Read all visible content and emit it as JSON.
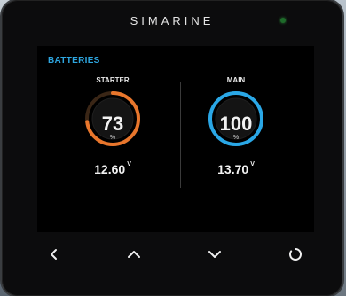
{
  "device": {
    "brand": "SIMARINE"
  },
  "screen": {
    "title": "BATTERIES",
    "batteries": [
      {
        "label": "STARTER",
        "percent": 73,
        "percent_text": "73",
        "unit": "%",
        "voltage": "12.60",
        "voltage_unit": "V",
        "ring_color": "#e8762c"
      },
      {
        "label": "MAIN",
        "percent": 100,
        "percent_text": "100",
        "unit": "%",
        "voltage": "13.70",
        "voltage_unit": "V",
        "ring_color": "#2aa7e6"
      }
    ]
  },
  "buttons": {
    "back": "chevron-left-icon",
    "up": "chevron-up-icon",
    "down": "chevron-down-icon",
    "power": "circle-icon"
  },
  "colors": {
    "accent_blue": "#2ea6e0",
    "accent_orange": "#e8762c",
    "led": "#1e6b2a"
  }
}
